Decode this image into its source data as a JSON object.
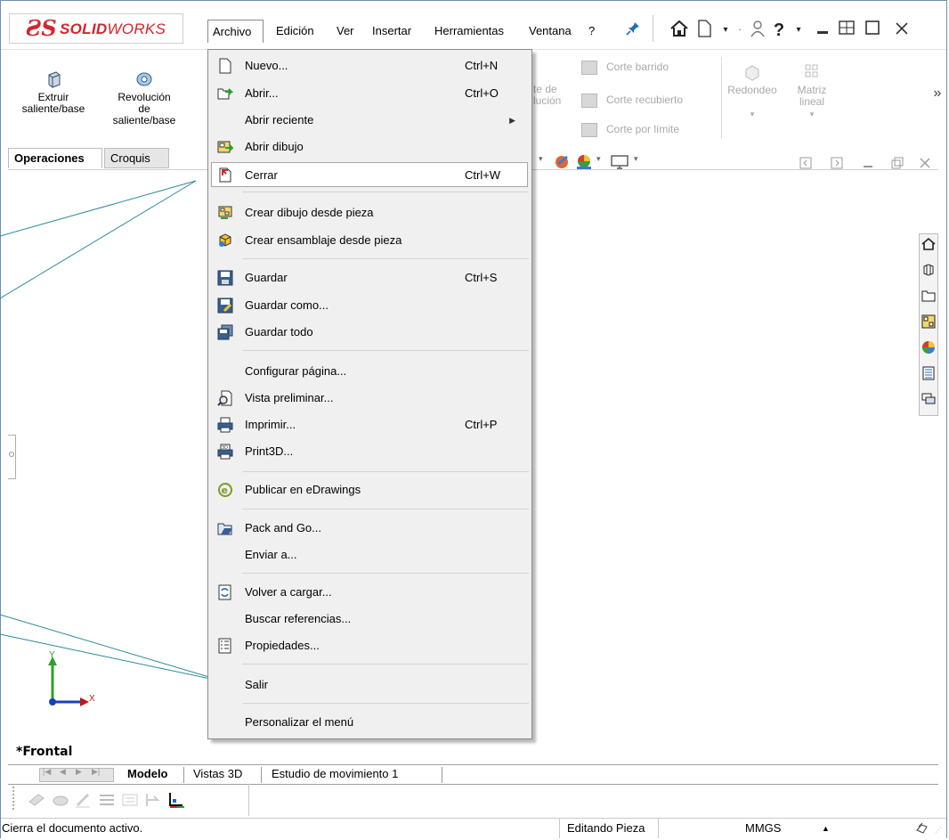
{
  "app": {
    "logo_ds": "ƧS",
    "logo_solid": "SOLID",
    "logo_works": "WORKS"
  },
  "menubar": {
    "items": [
      "Archivo",
      "Edición",
      "Ver",
      "Insertar",
      "Herramientas",
      "Ventana",
      "?"
    ],
    "pin_icon": "pin-icon",
    "icons": [
      "home-icon",
      "new-document-icon",
      "dropdown-arrow",
      "user-icon",
      "help-icon",
      "minimize-icon",
      "tile-icon",
      "maximize-icon",
      "close-icon"
    ]
  },
  "command_manager": {
    "left": [
      {
        "label_lines": [
          "Extruir",
          "saliente/base"
        ],
        "icon": "extrude-icon"
      },
      {
        "label_lines": [
          "Revolución",
          "de",
          "saliente/base"
        ],
        "icon": "revolve-icon"
      }
    ],
    "partial": [
      {
        "label_lines": [
          "te de",
          "lución"
        ],
        "icon": "revolve-cut-icon"
      }
    ],
    "right_column": [
      {
        "label": "Corte barrido",
        "icon": "swept-cut-icon"
      },
      {
        "label": "Corte recubierto",
        "icon": "lofted-cut-icon"
      },
      {
        "label": "Corte por límite",
        "icon": "boundary-cut-icon"
      }
    ],
    "features": [
      {
        "label": "Redondeo",
        "icon": "fillet-icon"
      },
      {
        "label_lines": [
          "Matriz",
          "lineal"
        ],
        "icon": "linear-pattern-icon"
      }
    ],
    "more": "»"
  },
  "tabs": {
    "operaciones": "Operaciones",
    "croquis": "Croquis"
  },
  "file_menu": {
    "items": [
      {
        "label": "Nuevo...",
        "shortcut": "Ctrl+N",
        "icon": "new-icon"
      },
      {
        "label": "Abrir...",
        "shortcut": "Ctrl+O",
        "icon": "open-icon"
      },
      {
        "label": "Abrir reciente",
        "shortcut": "",
        "icon": "",
        "submenu": true
      },
      {
        "label": "Abrir dibujo",
        "shortcut": "",
        "icon": "open-drawing-icon"
      },
      {
        "label": "Cerrar",
        "shortcut": "Ctrl+W",
        "icon": "close-document-icon",
        "highlighted": true
      },
      {
        "label": "Crear dibujo desde pieza",
        "shortcut": "",
        "icon": "make-drawing-icon"
      },
      {
        "label": "Crear ensamblaje desde pieza",
        "shortcut": "",
        "icon": "make-assembly-icon"
      },
      {
        "label": "Guardar",
        "shortcut": "Ctrl+S",
        "icon": "save-icon"
      },
      {
        "label": "Guardar como...",
        "shortcut": "",
        "icon": "save-as-icon"
      },
      {
        "label": "Guardar todo",
        "shortcut": "",
        "icon": "save-all-icon"
      },
      {
        "label": "Configurar página...",
        "shortcut": "",
        "icon": ""
      },
      {
        "label": "Vista preliminar...",
        "shortcut": "",
        "icon": "print-preview-icon"
      },
      {
        "label": "Imprimir...",
        "shortcut": "Ctrl+P",
        "icon": "print-icon"
      },
      {
        "label": "Print3D...",
        "shortcut": "",
        "icon": "print3d-icon"
      },
      {
        "label": "Publicar en eDrawings",
        "shortcut": "",
        "icon": "edrawings-icon"
      },
      {
        "label": "Pack and Go...",
        "shortcut": "",
        "icon": "pack-and-go-icon"
      },
      {
        "label": "Enviar a...",
        "shortcut": "",
        "icon": ""
      },
      {
        "label": "Volver a cargar...",
        "shortcut": "",
        "icon": "reload-icon"
      },
      {
        "label": "Buscar referencias...",
        "shortcut": "",
        "icon": ""
      },
      {
        "label": "Propiedades...",
        "shortcut": "",
        "icon": "properties-icon"
      },
      {
        "label": "Salir",
        "shortcut": "",
        "icon": ""
      },
      {
        "label": "Personalizar el menú",
        "shortcut": "",
        "icon": ""
      }
    ]
  },
  "viewport": {
    "view_label": "*Frontal",
    "axis_x": "X",
    "axis_y": "Y"
  },
  "bottom_tabs": {
    "items": [
      "Modelo",
      "Vistas 3D",
      "Estudio de movimiento 1"
    ]
  },
  "status_bar": {
    "message": "Cierra el documento activo.",
    "mode": "Editando Pieza",
    "units": "MMGS",
    "units_arrow": "▲"
  },
  "task_pane": {
    "icons": [
      "home-icon",
      "parts-icon",
      "folder-icon",
      "view-palette-icon",
      "appearances-icon",
      "custom-properties-icon",
      "forum-icon"
    ]
  }
}
